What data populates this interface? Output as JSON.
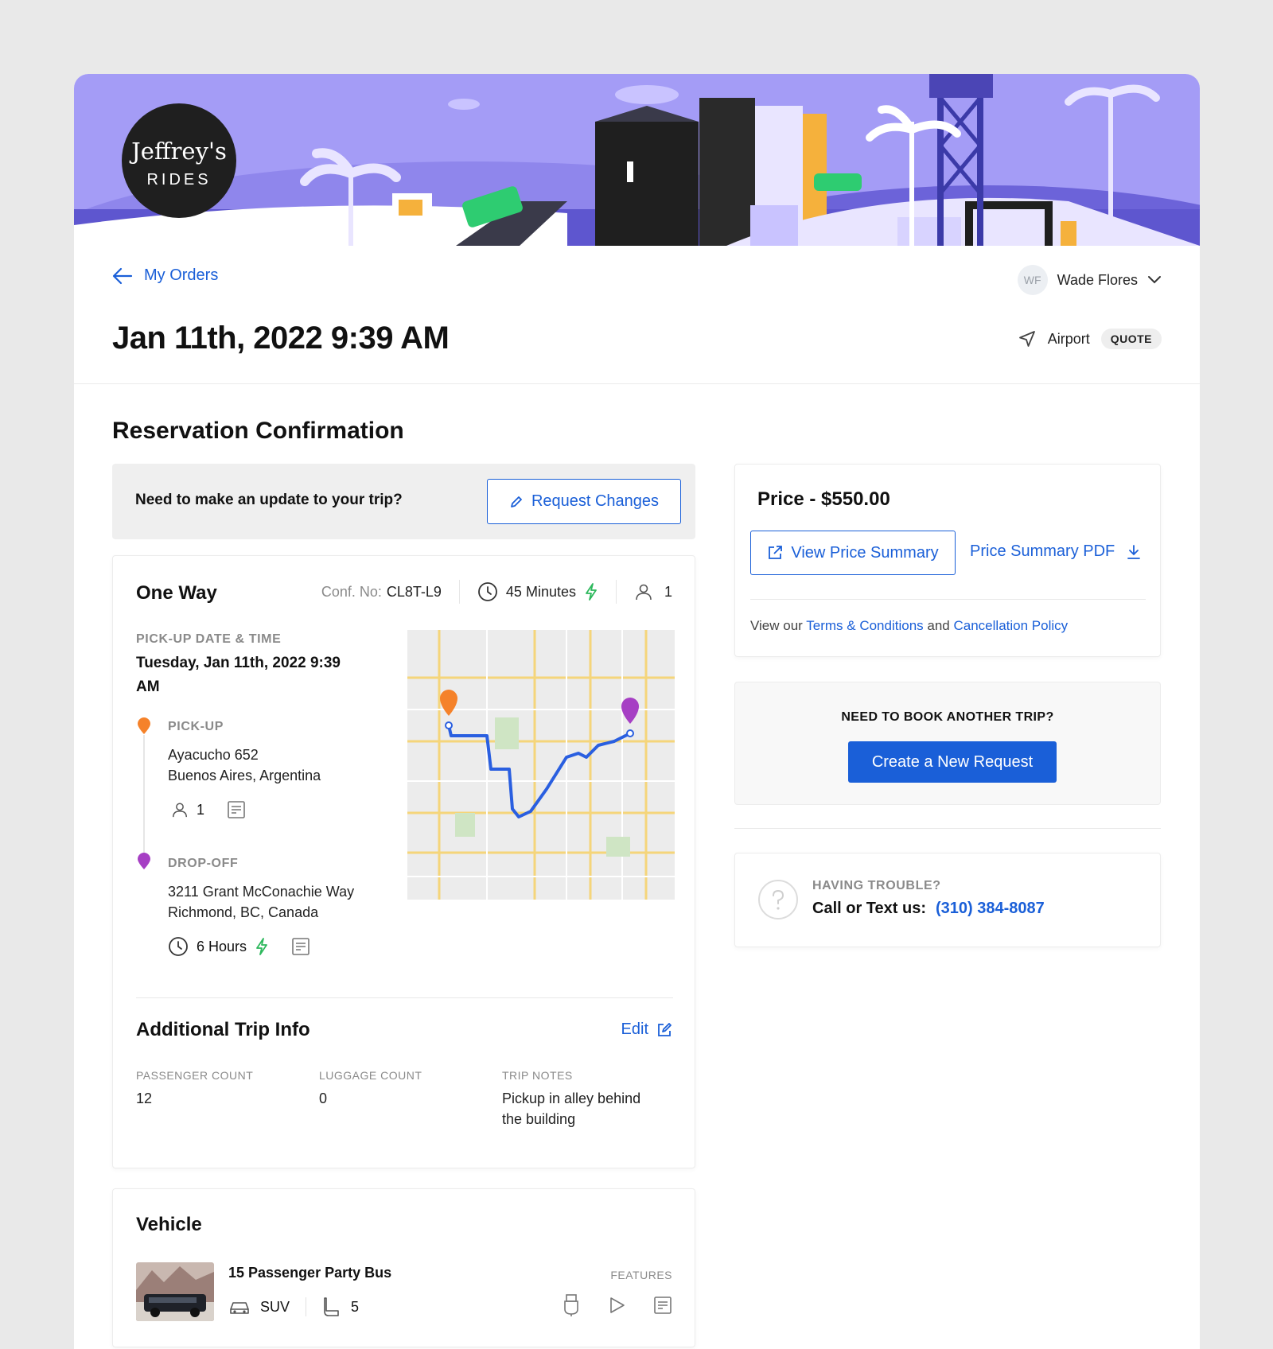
{
  "brand": {
    "name_line1": "Jeffrey's",
    "name_line2": "RIDES"
  },
  "nav": {
    "back_label": "My Orders"
  },
  "user": {
    "initials": "WF",
    "name": "Wade Flores"
  },
  "order": {
    "title": "Jan 11th, 2022 9:39 AM",
    "type": "Airport",
    "status_badge": "QUOTE"
  },
  "section_title": "Reservation Confirmation",
  "update_box": {
    "question": "Need to make an update to your trip?",
    "button_label": "Request Changes"
  },
  "trip": {
    "title": "One Way",
    "conf_label": "Conf. No:",
    "conf_number": "CL8T-L9",
    "duration": "45 Minutes",
    "passengers": "1",
    "pickup_datetime_label": "PICK-UP DATE & TIME",
    "pickup_datetime_line1": "Tuesday, Jan 11th, 2022 9:39",
    "pickup_datetime_line2": "AM",
    "pickup": {
      "label": "PICK-UP",
      "address_line1": "Ayacucho 652",
      "address_line2": "Buenos Aires, Argentina",
      "passengers": "1"
    },
    "dropoff": {
      "label": "DROP-OFF",
      "address_line1": "3211 Grant McConachie Way",
      "address_line2": "Richmond, BC, Canada",
      "duration": "6 Hours"
    }
  },
  "additional_info": {
    "title": "Additional Trip Info",
    "edit_label": "Edit",
    "passenger_count_label": "PASSENGER COUNT",
    "passenger_count": "12",
    "luggage_count_label": "LUGGAGE COUNT",
    "luggage_count": "0",
    "trip_notes_label": "TRIP NOTES",
    "trip_notes_line1": "Pickup in alley behind",
    "trip_notes_line2": "the building"
  },
  "vehicle": {
    "section_title": "Vehicle",
    "name": "15 Passenger Party Bus",
    "type": "SUV",
    "seats": "5",
    "features_label": "FEATURES"
  },
  "price": {
    "title": "Price - $550.00",
    "view_summary_label": "View Price Summary",
    "pdf_label": "Price Summary PDF",
    "terms_prefix": "View our",
    "terms_link": "Terms & Conditions",
    "terms_and": "and",
    "cancellation_link": "Cancellation Policy"
  },
  "book_another": {
    "question": "NEED TO BOOK ANOTHER TRIP?",
    "button_label": "Create a New Request"
  },
  "support": {
    "label": "HAVING TROUBLE?",
    "prompt": "Call or Text us:",
    "phone": "(310) 384-8087"
  },
  "colors": {
    "accent": "#1a5fd8",
    "banner": "#a49cf6",
    "pickup_pin": "#f5822a",
    "dropoff_pin": "#a63fc4",
    "lightning": "#2db85c"
  }
}
